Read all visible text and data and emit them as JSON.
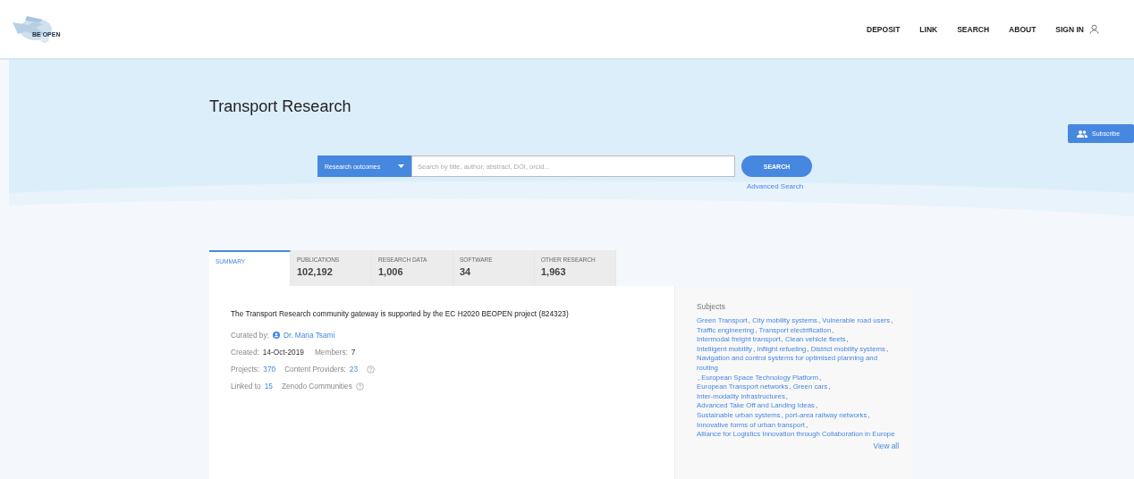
{
  "header": {
    "logo_text": "BE OPEN",
    "nav": [
      "DEPOSIT",
      "LINK",
      "SEARCH",
      "ABOUT",
      "SIGN IN"
    ]
  },
  "hero": {
    "title": "Transport Research",
    "subscribe": "Subscribe",
    "search": {
      "type_selector": "Research outcomes",
      "placeholder": "Search by title, author, abstract, DOI, orcid...",
      "button": "SEARCH",
      "advanced": "Advanced Search"
    }
  },
  "tabs": [
    {
      "label": "SUMMARY",
      "selected": true
    },
    {
      "label": "PUBLICATIONS",
      "count": "102,192",
      "selected": false
    },
    {
      "label": "RESEARCH DATA",
      "count": "1,006",
      "selected": false
    },
    {
      "label": "SOFTWARE",
      "count": "34",
      "selected": false
    },
    {
      "label": "OTHER RESEARCH",
      "count": "1,963",
      "selected": false
    }
  ],
  "summary": {
    "description": "The Transport Research community gateway is supported by the EC H2020 BEOPEN project (824323)",
    "curated_label": "Curated by:",
    "curator": "Dr. Maria Tsami",
    "created_label": "Created:",
    "created": "14-Oct-2019",
    "members_label": "Members:",
    "members": "7",
    "projects_label": "Projects:",
    "projects": "370",
    "providers_label": "Content Providers:",
    "providers": "23",
    "linked_label": "Linked to",
    "linked": "15",
    "zenodo_label": "Zenodo Communities"
  },
  "subjects": {
    "title": "Subjects",
    "separator": ",",
    "items": [
      "Green Transport",
      "City mobility systems",
      "Vulnerable road users",
      "Traffic engineering",
      "Transport electrification",
      "Intermodal freight transport",
      "Clean vehicle fleets",
      "Intelligent mobility",
      "Inflight refueling",
      "District mobility systems",
      "Navigation and control systems for optimised planning and routing",
      "European Space Technology Platform",
      "European Transport networks",
      "Green cars",
      "Inter-modality infrastructures",
      "Advanced Take Off and Landing Ideas",
      "Sustainable urban systems",
      "port-area railway networks",
      "Innovative forms of urban transport",
      "Alliance for Logistics Innovation through Collaboration in Europe"
    ],
    "view_all": "View all"
  }
}
